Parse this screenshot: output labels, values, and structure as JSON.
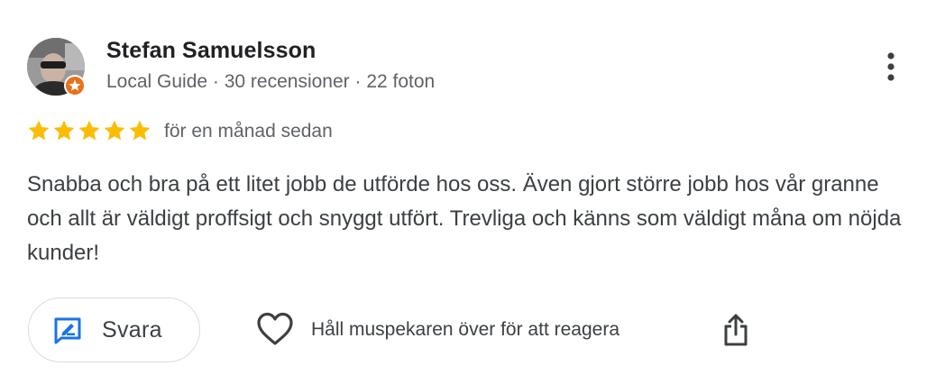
{
  "review": {
    "author": {
      "name": "Stefan Samuelsson",
      "meta": "Local Guide · 30 recensioner · 22 foton",
      "avatar_icon": "avatar-photo",
      "badge_icon": "local-guide-star-badge",
      "badge_color": "#e8711a"
    },
    "rating": {
      "value": 5,
      "max": 5,
      "star_color": "#fbbc04",
      "star_icon": "star-icon"
    },
    "date": "för en månad sedan",
    "text": "Snabba och bra på ett litet jobb de utförde hos oss. Även gjort större jobb hos vår granne och allt är väldigt proffsigt och snyggt utfört. Trevliga och känns som väldigt måna om nöjda kunder!",
    "actions": {
      "reply_label": "Svara",
      "reply_icon": "reply-edit-icon",
      "reply_icon_color": "#1a73e8",
      "react_icon": "heart-outline-icon",
      "react_hint": "Håll muspekaren över för att reagera",
      "share_icon": "share-icon",
      "more_icon": "more-vertical-icon"
    }
  }
}
